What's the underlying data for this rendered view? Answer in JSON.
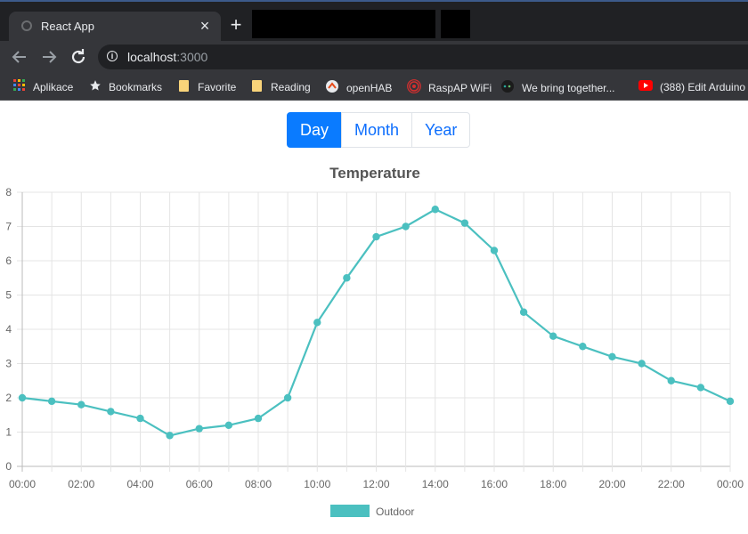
{
  "browser": {
    "tab_title": "React App",
    "tab_close": "×",
    "new_tab": "+",
    "url_host": "localhost",
    "url_port": ":3000",
    "bookmarks": [
      {
        "label": "Aplikace",
        "icon": "apps-grid-icon"
      },
      {
        "label": "Bookmarks",
        "icon": "star-icon"
      },
      {
        "label": "Favorite",
        "icon": "folder-icon"
      },
      {
        "label": "Reading",
        "icon": "folder-icon"
      },
      {
        "label": "openHAB",
        "icon": "openhab-icon"
      },
      {
        "label": "RaspAP WiFi",
        "icon": "wifi-icon"
      },
      {
        "label": "We bring together...",
        "icon": "site-icon"
      },
      {
        "label": "(388) Edit Arduino",
        "icon": "youtube-icon"
      }
    ]
  },
  "period_selector": {
    "options": [
      "Day",
      "Month",
      "Year"
    ],
    "selected": "Day"
  },
  "colors": {
    "accent": "#0a7bff",
    "series": "#4bc0c0",
    "browser_dark": "#202124",
    "browser_toolbar": "#35363a"
  },
  "chart_data": {
    "type": "line",
    "title": "Temperature",
    "x": [
      "00:00",
      "01:00",
      "02:00",
      "03:00",
      "04:00",
      "05:00",
      "06:00",
      "07:00",
      "08:00",
      "09:00",
      "10:00",
      "11:00",
      "12:00",
      "13:00",
      "14:00",
      "15:00",
      "16:00",
      "17:00",
      "18:00",
      "19:00",
      "20:00",
      "21:00",
      "22:00",
      "23:00",
      "00:00"
    ],
    "x_tick_labels": [
      "00:00",
      "02:00",
      "04:00",
      "06:00",
      "08:00",
      "10:00",
      "12:00",
      "14:00",
      "16:00",
      "18:00",
      "20:00",
      "22:00",
      "00:00"
    ],
    "series": [
      {
        "name": "Outdoor",
        "values": [
          2.0,
          1.9,
          1.8,
          1.6,
          1.4,
          0.9,
          1.1,
          1.2,
          1.4,
          2.0,
          4.2,
          5.5,
          6.7,
          7.0,
          7.5,
          7.1,
          6.3,
          4.5,
          3.8,
          3.5,
          3.2,
          3.0,
          2.5,
          2.3,
          1.9
        ]
      }
    ],
    "ylim": [
      0,
      8
    ],
    "y_ticks": [
      0,
      1,
      2,
      3,
      4,
      5,
      6,
      7,
      8
    ],
    "grid": true,
    "legend": "bottom"
  }
}
